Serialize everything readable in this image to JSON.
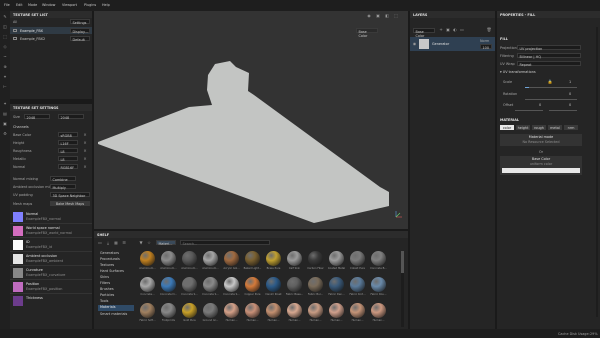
{
  "menubar": {
    "items": [
      "File",
      "Edit",
      "Mode",
      "Window",
      "Viewport",
      "Plugins",
      "Help"
    ]
  },
  "texture_set_list": {
    "title": "TEXTURE SET LIST",
    "settings_label": "Settings",
    "filter_value": "All",
    "items": [
      {
        "name": "Example_FBX",
        "shader": "Display..."
      },
      {
        "name": "Example_FBX2",
        "shader": "Default"
      }
    ]
  },
  "texture_set_settings": {
    "title": "TEXTURE SET SETTINGS",
    "size_label": "Size",
    "size_value": "2048",
    "size_value2": "2048",
    "channels_label": "Channels",
    "channels": [
      {
        "name": "Base Color",
        "format": "sRGB8"
      },
      {
        "name": "Height",
        "format": "L16F"
      },
      {
        "name": "Roughness",
        "format": "L8"
      },
      {
        "name": "Metallic",
        "format": "L8"
      },
      {
        "name": "Normal",
        "format": "RGB16F"
      }
    ],
    "normal_mixing_label": "Normal mixing",
    "normal_mixing_value": "Combine",
    "ambient_occlusion_label": "Ambient occlusion mixing",
    "ambient_occlusion_value": "Multiply",
    "uv_padding_label": "UV padding",
    "uv_padding_value": "3D Space Neighbor",
    "mesh_maps_label": "Mesh maps",
    "bake_button": "Bake Mesh Maps",
    "mesh_maps": [
      {
        "name": "Normal",
        "file": "ExampleFBX_normal",
        "color": "#8080ff"
      },
      {
        "name": "World space normal",
        "file": "ExampleFBX_world_normal",
        "color": "#d46ec0"
      },
      {
        "name": "ID",
        "file": "ExampleFBX_id",
        "color": "#ffffff"
      },
      {
        "name": "Ambient occlusion",
        "file": "ExampleFBX_ambient",
        "color": "#e6e6e6"
      },
      {
        "name": "Curvature",
        "file": "ExampleFBX_curvature",
        "color": "#888888"
      },
      {
        "name": "Position",
        "file": "ExampleFBX_position",
        "color": "#c06cc0"
      },
      {
        "name": "Thickness",
        "file": "",
        "color": "#6c3c8c"
      }
    ]
  },
  "viewport": {
    "material_dropdown": "Base Color",
    "model_color": "#c3c5c3"
  },
  "shelf": {
    "title": "SHELF",
    "filter_tag": "Materi...",
    "search_placeholder": "Search...",
    "categories": [
      "Generators",
      "Procedurals",
      "Textures",
      "Hard Surfaces",
      "Skins",
      "Filters",
      "Brushes",
      "Particles",
      "Tools",
      "Materials",
      "Smart materials"
    ],
    "active_category": "Materials",
    "materials": [
      {
        "name": "Aluminium...",
        "color": "#c08020"
      },
      {
        "name": "Aluminium...",
        "color": "#8c8c8c"
      },
      {
        "name": "Aluminium...",
        "color": "#5a5a5a"
      },
      {
        "name": "Aluminium...",
        "color": "#a5a5a5"
      },
      {
        "name": "Acrylic Gol...",
        "color": "#a06a40"
      },
      {
        "name": "Baked Light...",
        "color": "#7a6030"
      },
      {
        "name": "Brass Pure",
        "color": "#c0a030"
      },
      {
        "name": "Calf Skin",
        "color": "#9a9a9a"
      },
      {
        "name": "Carbon Fiber",
        "color": "#3a3a3a"
      },
      {
        "name": "Coated Metal",
        "color": "#9c9c9c"
      },
      {
        "name": "Cobalt Pure",
        "color": "#7a7a7a"
      },
      {
        "name": "Concrete B...",
        "color": "#808080"
      },
      {
        "name": "Concrete...",
        "color": "#a8a8a8"
      },
      {
        "name": "Concrete D...",
        "color": "#3c7ab8"
      },
      {
        "name": "Concrete S...",
        "color": "#6e6e6e"
      },
      {
        "name": "Concrete S...",
        "color": "#8a8a8a"
      },
      {
        "name": "Concrete S...",
        "color": "#c8c8c8"
      },
      {
        "name": "Copper Pure",
        "color": "#d47a3a"
      },
      {
        "name": "Denim Rivet",
        "color": "#2c5a88"
      },
      {
        "name": "Fabric Base...",
        "color": "#606060"
      },
      {
        "name": "Fabric Bur...",
        "color": "#7a6c5a"
      },
      {
        "name": "Fabric Den...",
        "color": "#3a5a7a"
      },
      {
        "name": "Fabric Knit...",
        "color": "#5a7a9a"
      },
      {
        "name": "Fabric Rou...",
        "color": "#6a8aaa"
      },
      {
        "name": "Fabric Soft...",
        "color": "#a08060"
      },
      {
        "name": "Footprints",
        "color": "#888888"
      },
      {
        "name": "Gold Pure",
        "color": "#c8a028"
      },
      {
        "name": "Ground Gr...",
        "color": "#7a7a7a"
      },
      {
        "name": "Human...",
        "color": "#d4a088"
      },
      {
        "name": "Human...",
        "color": "#c89078"
      },
      {
        "name": "Human...",
        "color": "#c49070"
      },
      {
        "name": "Human...",
        "color": "#d8a890"
      },
      {
        "name": "Human...",
        "color": "#c89c84"
      },
      {
        "name": "Human...",
        "color": "#d0a08c"
      },
      {
        "name": "Human...",
        "color": "#c49478"
      },
      {
        "name": "Human...",
        "color": "#cc9880"
      }
    ]
  },
  "layers": {
    "title": "LAYERS",
    "mode_value": "Base Color",
    "layer_name": "Generator",
    "blend_mode": "Norm",
    "opacity": "100"
  },
  "properties": {
    "title": "PROPERTIES - FILL",
    "fill_section": "FILL",
    "projection_label": "Projection",
    "projection_value": "UV projection",
    "filtering_label": "Filtering",
    "filtering_value": "Bilinear | HQ",
    "uv_wrap_label": "UV Wrap",
    "uv_wrap_value": "Repeat",
    "uv_transform_label": "UV transformations",
    "scale_label": "Scale",
    "scale_value": "1",
    "rotation_label": "Rotation",
    "rotation_value": "0",
    "offset_label": "Offset",
    "offset_x": "0",
    "offset_y": "0",
    "material_section": "MATERIAL",
    "channel_buttons": [
      "color",
      "height",
      "rough",
      "metal",
      "nrm"
    ],
    "material_mode_label": "Material mode",
    "material_mode_hint": "No Resource Selected",
    "or_label": "Or",
    "base_color_label": "Base Color",
    "base_color_sub": "uniform color",
    "base_color_swatch": "#e8e8e8"
  },
  "status_bar": {
    "text": "Cache Disk Usage:",
    "percent": "29%"
  }
}
